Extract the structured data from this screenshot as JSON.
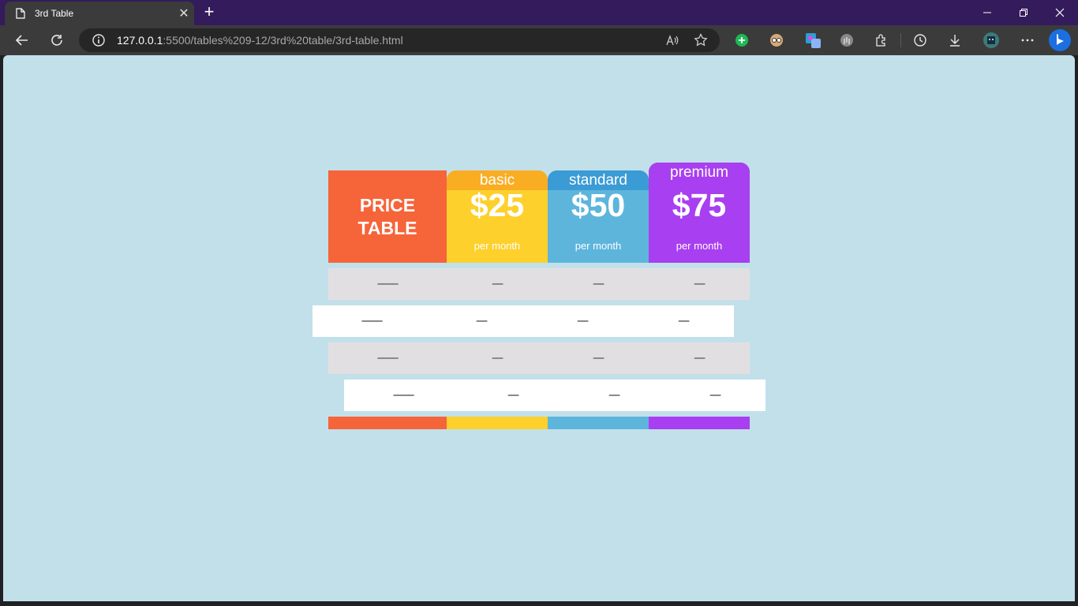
{
  "browser": {
    "tab_title": "3rd Table",
    "tab_close": "✕",
    "new_tab": "+",
    "url_host": "127.0.0.1",
    "url_path": ":5500/tables%209-12/3rd%20table/3rd-table.html"
  },
  "price_table": {
    "title_line1": "PRICE",
    "title_line2": "TABLE",
    "plans": [
      {
        "name": "basic",
        "price": "$25",
        "period": "per month",
        "color": "#fdd02c",
        "header_color": "#f9ad23"
      },
      {
        "name": "standard",
        "price": "$50",
        "period": "per month",
        "color": "#5db5dc",
        "header_color": "#3a9bd5"
      },
      {
        "name": "premium",
        "price": "$75",
        "period": "per month",
        "color": "#a83ff0",
        "header_color": "#a83ff0"
      }
    ],
    "title_color": "#f6643a",
    "rows": [
      [
        "━━━━",
        "━━",
        "━━",
        "━━"
      ],
      [
        "━━━━",
        "━━",
        "━━",
        "━━"
      ],
      [
        "━━━━",
        "━━",
        "━━",
        "━━"
      ],
      [
        "━━━━",
        "━━",
        "━━",
        "━━"
      ]
    ]
  },
  "page_background": "#c2e0ea"
}
